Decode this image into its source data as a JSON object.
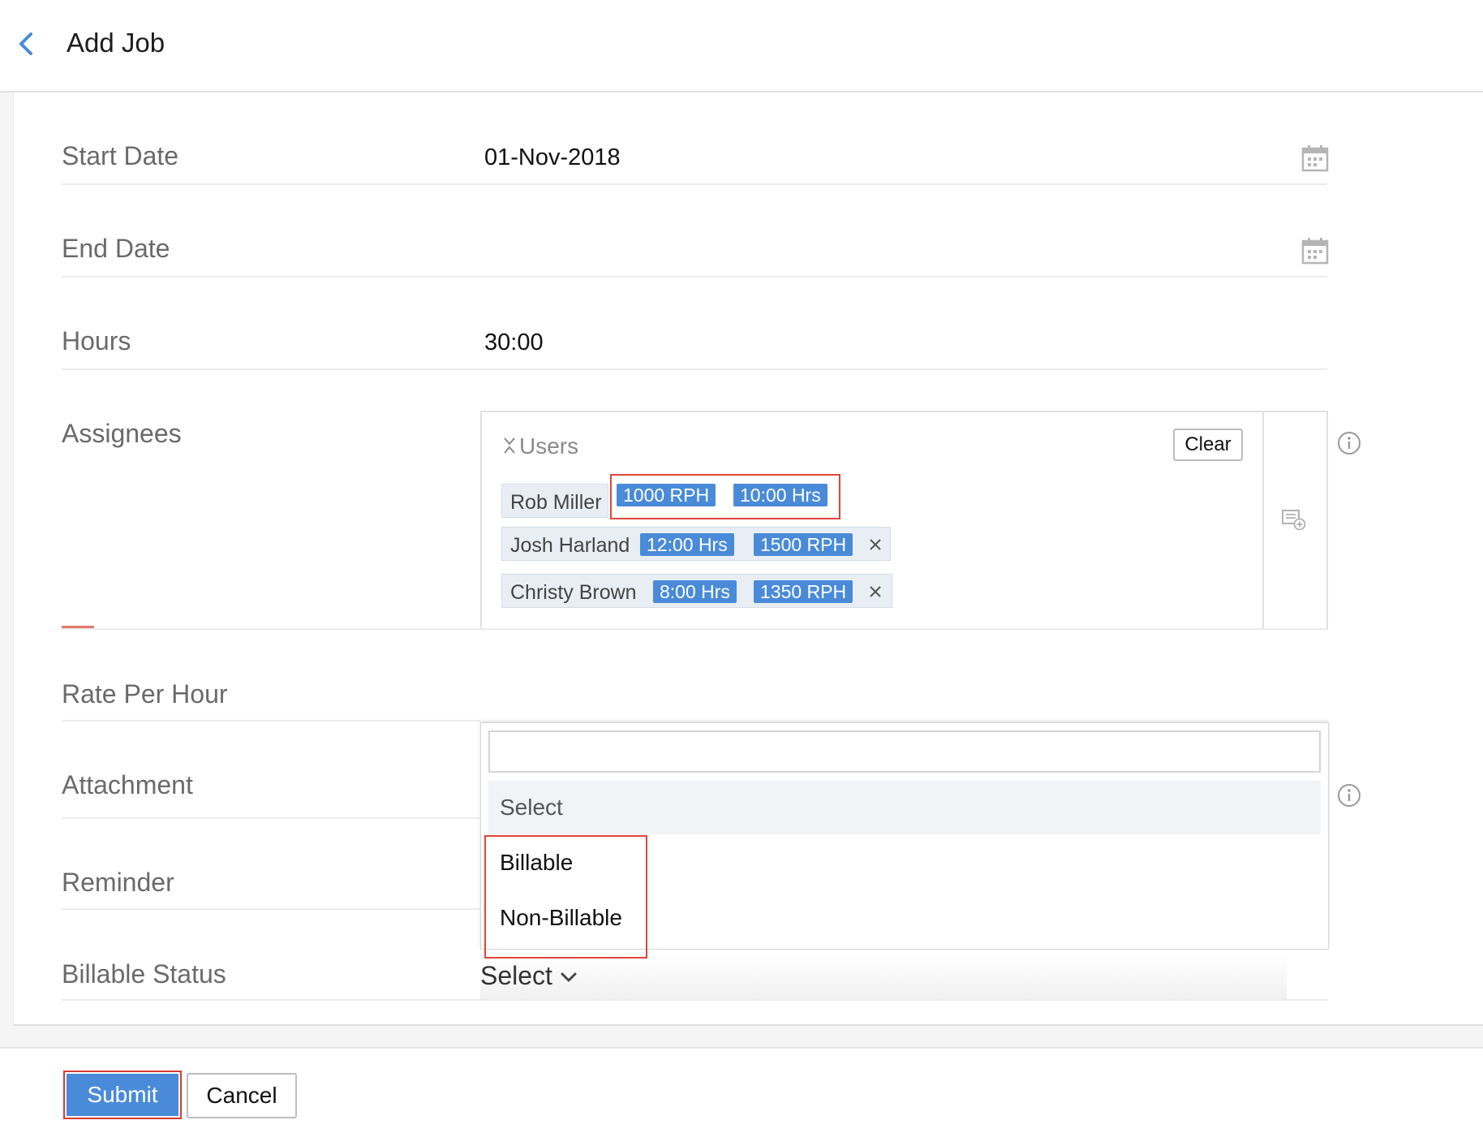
{
  "header": {
    "title": "Add Job"
  },
  "fields": {
    "start_date": {
      "label": "Start Date",
      "value": "01-Nov-2018"
    },
    "end_date": {
      "label": "End Date",
      "value": ""
    },
    "hours": {
      "label": "Hours",
      "value": "30:00"
    },
    "assignees": {
      "label": "Assignees"
    },
    "rate_per_hour": {
      "label": "Rate Per Hour"
    },
    "attachment": {
      "label": "Attachment"
    },
    "reminder": {
      "label": "Reminder"
    },
    "billable_status": {
      "label": "Billable Status",
      "value": "Select"
    }
  },
  "assignee_panel": {
    "group_label": "Users",
    "clear_label": "Clear",
    "users": [
      {
        "name": "Rob Miller",
        "tags": [
          "1000 RPH",
          "10:00 Hrs"
        ]
      },
      {
        "name": "Josh Harland",
        "tags": [
          "12:00 Hrs",
          "1500 RPH"
        ]
      },
      {
        "name": "Christy Brown",
        "tags": [
          "8:00 Hrs",
          "1350 RPH"
        ]
      }
    ]
  },
  "dropdown": {
    "search_value": "",
    "options": [
      "Select",
      "Billable",
      "Non-Billable"
    ],
    "selected": "Select"
  },
  "footer": {
    "submit_label": "Submit",
    "cancel_label": "Cancel"
  },
  "icons": {
    "back": "chevron-left-icon",
    "calendar": "calendar-icon",
    "info": "info-icon",
    "add_list": "add-list-icon",
    "remove": "close-icon",
    "collapse": "collapse-icon",
    "dropdown": "chevron-down-icon"
  },
  "colors": {
    "accent": "#4a8bd9",
    "highlight": "#e0453a",
    "label": "#6a6a6a"
  }
}
